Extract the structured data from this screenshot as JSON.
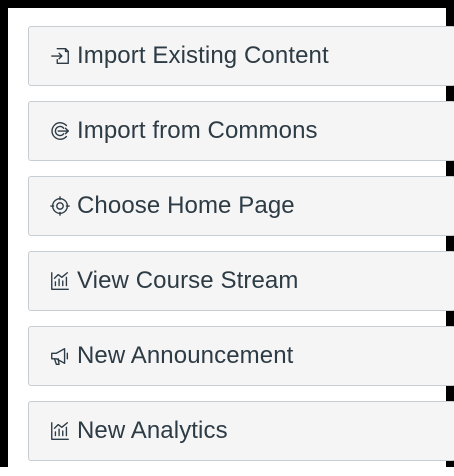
{
  "buttons": [
    {
      "label": "Import Existing Content",
      "icon": "import-icon"
    },
    {
      "label": "Import from Commons",
      "icon": "commons-icon"
    },
    {
      "label": "Choose Home Page",
      "icon": "target-icon"
    },
    {
      "label": "View Course Stream",
      "icon": "stream-icon"
    },
    {
      "label": "New Announcement",
      "icon": "announcement-icon"
    },
    {
      "label": "New Analytics",
      "icon": "analytics-icon"
    }
  ]
}
